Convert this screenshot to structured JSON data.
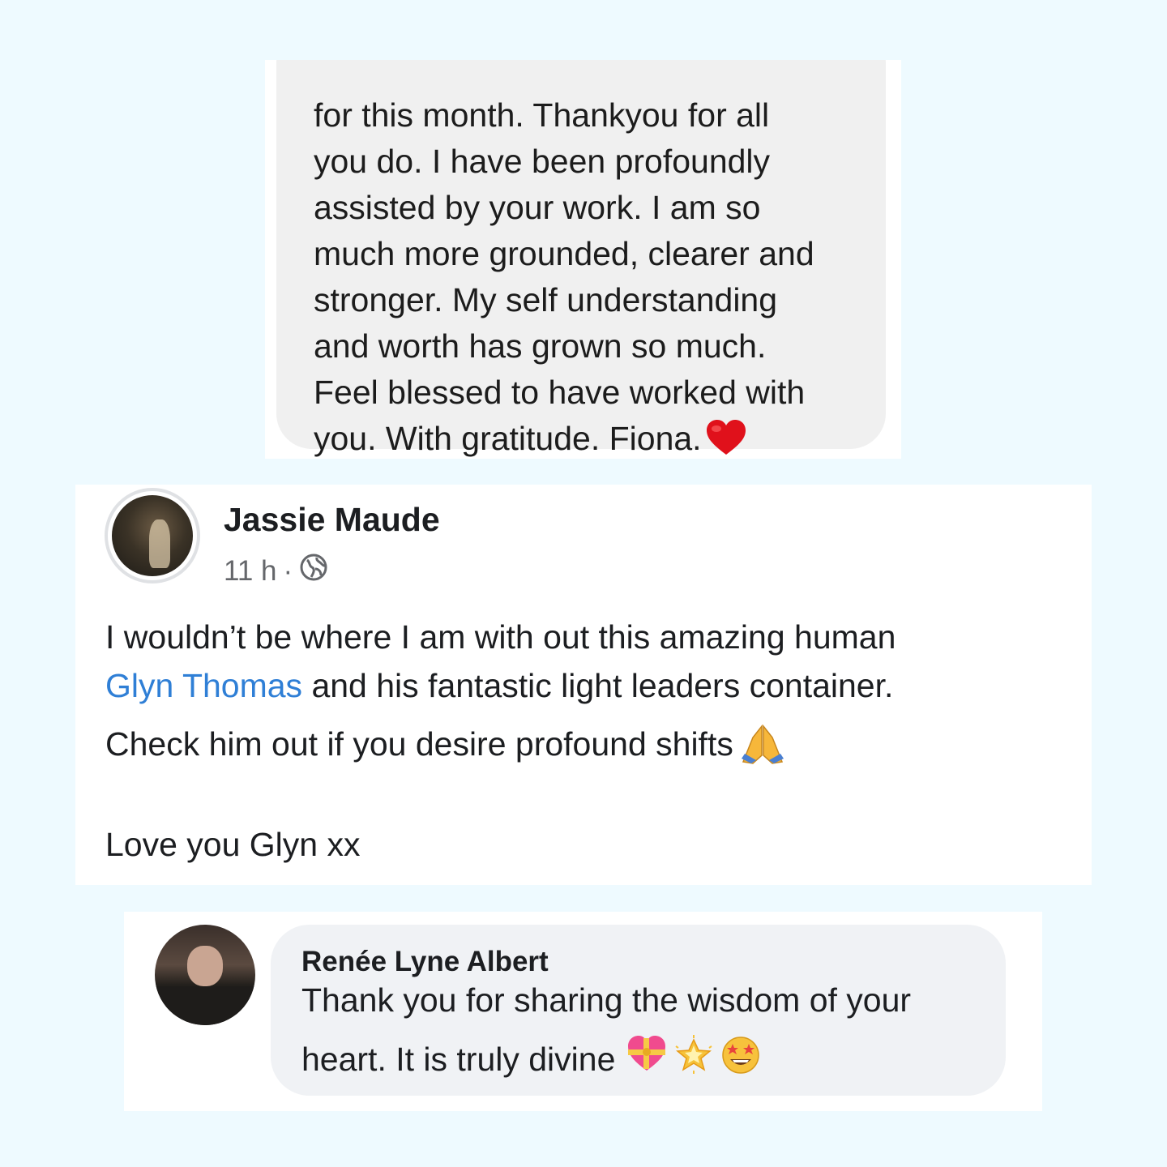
{
  "message": {
    "lines": [
      "for this month. Thankyou for all",
      "you do. I have been profoundly",
      "assisted by your work. I am so",
      "much more grounded, clearer and",
      "stronger. My self understanding",
      "and worth has grown so much.",
      "Feel blessed to have worked with",
      "you. With gratitude. Fiona."
    ],
    "icon": "red-heart-icon"
  },
  "post": {
    "author": "Jassie Maude",
    "time": "11 h",
    "separator": "·",
    "privacy_icon": "globe-icon",
    "line1": "I wouldn’t be where I am with out this amazing human",
    "mention": "Glyn Thomas",
    "line2_rest": " and his fantastic light leaders container.",
    "line3": "Check him out if you desire profound shifts",
    "line3_icon": "praying-hands-icon",
    "line4": "Love you Glyn xx"
  },
  "comment": {
    "author": "Renée Lyne Albert",
    "line1": "Thank you for sharing the wisdom of your",
    "line2": "heart. It is truly divine",
    "emoji_icons": [
      "heart-with-ribbon-icon",
      "glowing-star-icon",
      "star-struck-icon"
    ]
  },
  "colors": {
    "background": "#eefaff",
    "mention": "#2f7fd6",
    "bubble": "#f0f0f0",
    "comment_bubble": "#f0f2f5"
  }
}
